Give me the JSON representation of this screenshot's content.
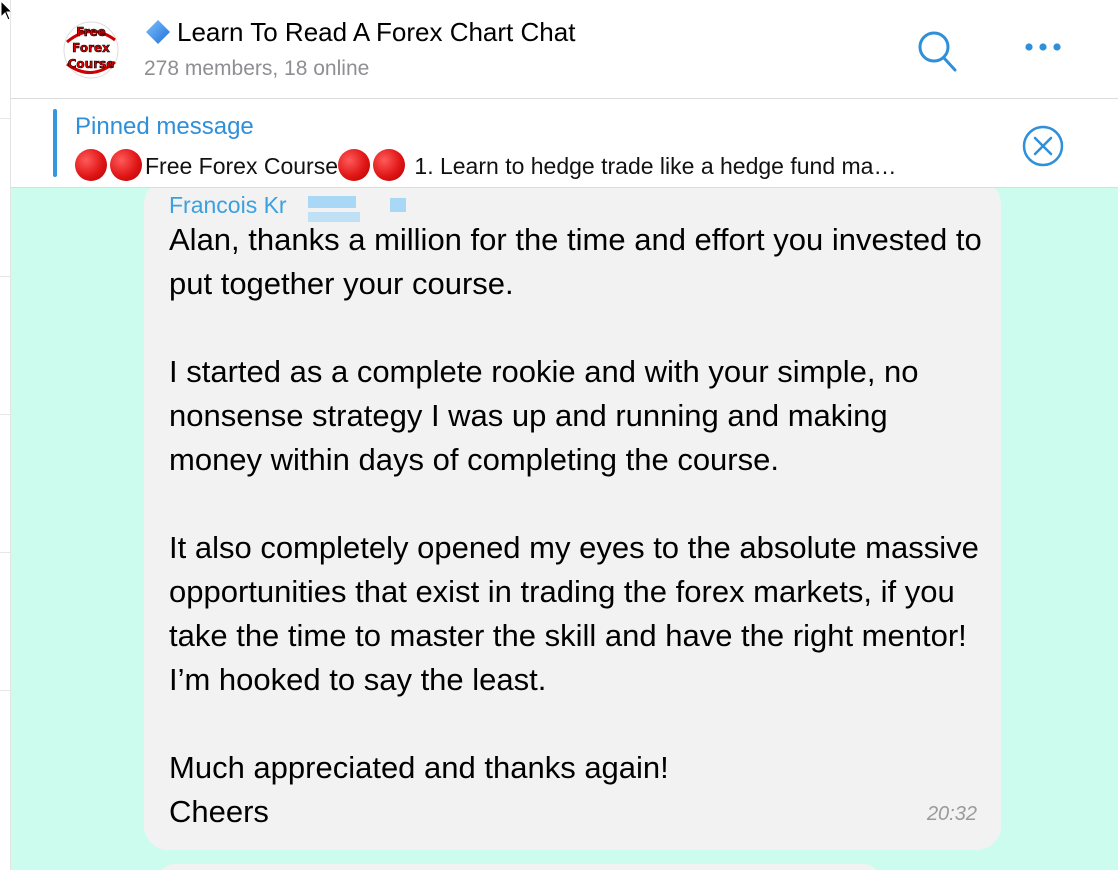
{
  "header": {
    "title": "Learn To Read A Forex Chart Chat",
    "subtitle": "278 members, 18 online",
    "avatar_lines": [
      "Free",
      "Forex",
      "Course"
    ]
  },
  "pinned": {
    "label": "Pinned message",
    "text": "Free Forex Course",
    "preview": " 1. Learn to hedge trade like a hedge fund ma…"
  },
  "message": {
    "sender": "Francois Kr",
    "paragraphs": [
      "Alan, thanks a million for the time and effort you invested to put together your course.",
      "I started as a complete rookie and with your simple, no nonsense strategy I was up and running and making money within days of completing the course.",
      "It also completely opened my eyes to the absolute massive opportunities that exist in trading the forex markets, if you take the time to master the skill and have the right mentor! I’m hooked to say the least.",
      "Much appreciated and thanks again!"
    ],
    "closing": "Cheers",
    "time": "20:32"
  },
  "colors": {
    "accent": "#3497e0",
    "chat_background": "#ccfcee",
    "bubble": "#f2f2f2",
    "red_dot": "#e01616"
  },
  "icons": {
    "title_prefix": "blue-diamond-icon",
    "search": "search-icon",
    "more": "more-icon",
    "close": "close-circle-icon",
    "pinned_emoji": "red-circle-icon"
  }
}
